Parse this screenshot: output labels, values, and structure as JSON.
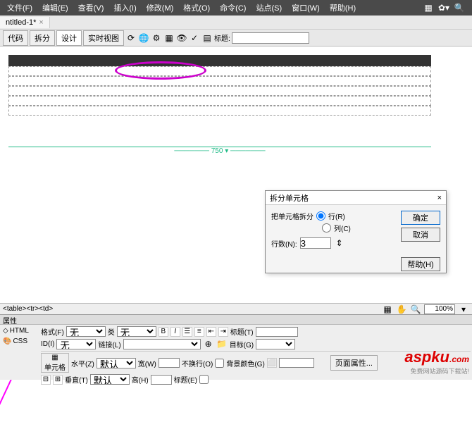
{
  "menu": {
    "file": "文件(F)",
    "edit": "编辑(E)",
    "view": "查看(V)",
    "insert": "插入(I)",
    "modify": "修改(M)",
    "format": "格式(O)",
    "commands": "命令(C)",
    "site": "站点(S)",
    "window": "窗口(W)",
    "help": "帮助(H)"
  },
  "tab": {
    "name": "ntitled-1*",
    "close": "×"
  },
  "viewbar": {
    "code": "代码",
    "split": "拆分",
    "design": "设计",
    "live": "实时视图",
    "title_label": "标题:",
    "title_value": ""
  },
  "canvas": {
    "ruler_width": "750"
  },
  "dialog": {
    "title": "拆分单元格",
    "close": "×",
    "split_label": "把单元格拆分",
    "row_opt": "行(R)",
    "col_opt": "列(C)",
    "rows_label": "行数(N):",
    "rows_value": "3",
    "ok": "确定",
    "cancel": "取消",
    "help": "帮助(H)"
  },
  "selector": {
    "path": "<table><tr><td>",
    "zoom": "100%"
  },
  "props": {
    "title": "属性",
    "html_tab": "HTML",
    "css_tab": "CSS",
    "format_label": "格式(F)",
    "format_val": "无",
    "id_label": "ID(I)",
    "id_val": "无",
    "class_label": "类",
    "class_val": "无",
    "link_label": "链接(L)",
    "link_val": "",
    "bold": "B",
    "italic": "I",
    "title_attr": "标题(T)",
    "target": "目标(G)",
    "cell_label": "单元格",
    "horiz": "水平(Z)",
    "horiz_val": "默认",
    "width": "宽(W)",
    "nowrap": "不换行(O)",
    "bgcolor": "背景颜色(G)",
    "pageprops": "页面属性...",
    "vert": "垂直(T)",
    "vert_val": "默认",
    "height": "高(H)",
    "header": "标题(E)"
  },
  "watermark": {
    "main": "aspku",
    "suffix": ".com",
    "sub": "免费网站源码下载站!"
  }
}
